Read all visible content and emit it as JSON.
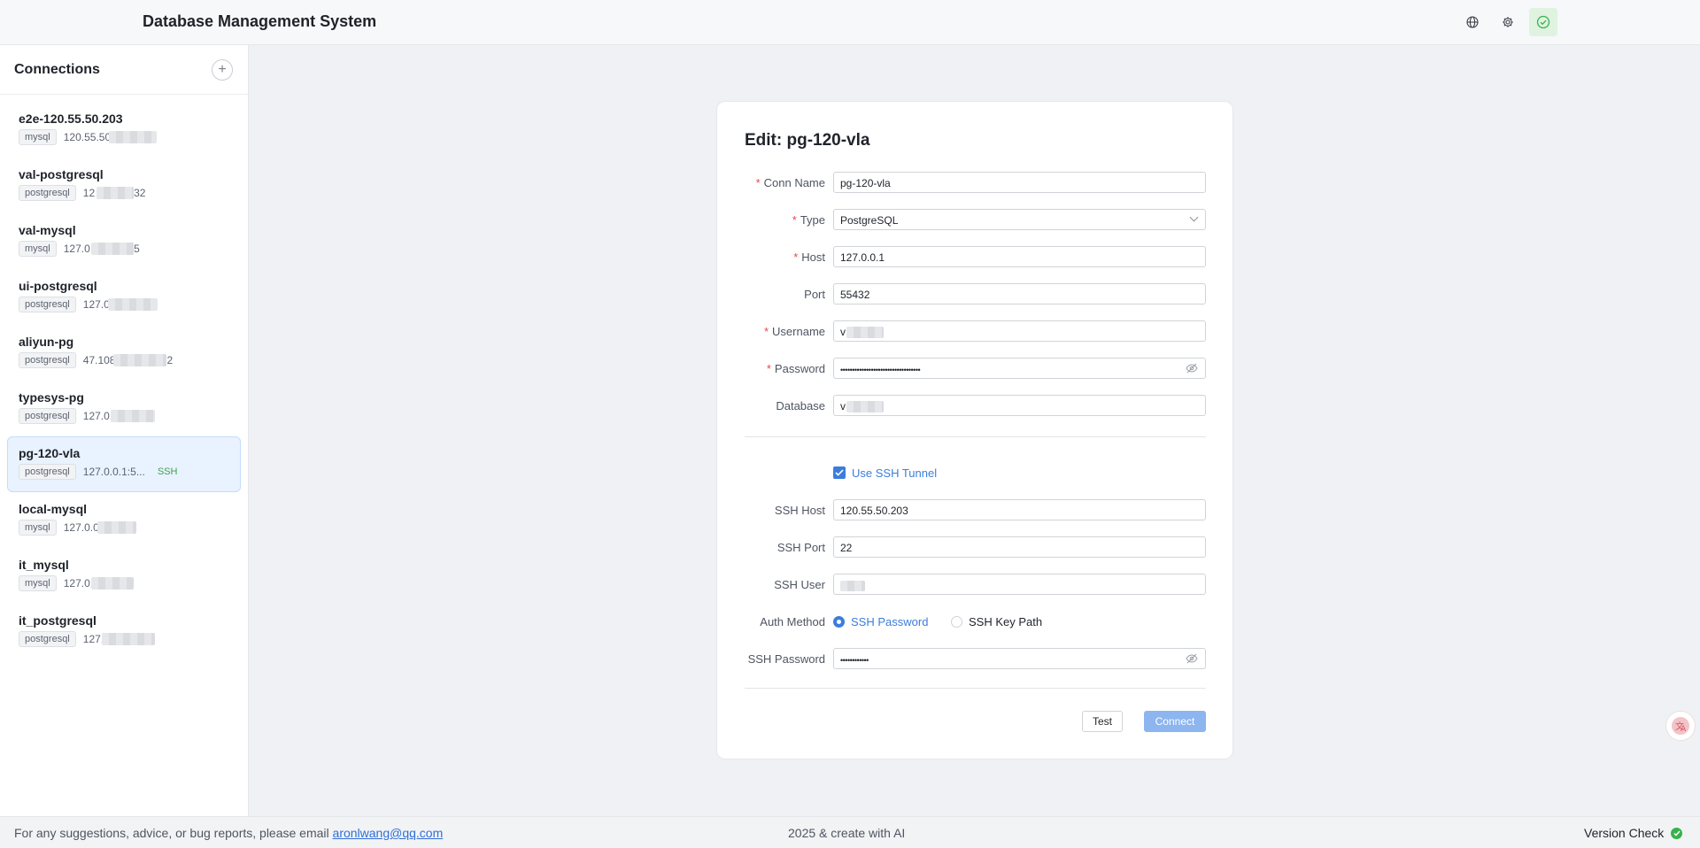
{
  "app": {
    "title": "Database Management System"
  },
  "topbar": {
    "icons": [
      "globe-icon",
      "gear-icon",
      "check-circle-icon"
    ]
  },
  "sidebar": {
    "title": "Connections",
    "add_icon": "plus-icon",
    "items": [
      {
        "name": "e2e-120.55.50.203",
        "type": "mysql",
        "host": "120.55.50",
        "ssh": ""
      },
      {
        "name": "val-postgresql",
        "type": "postgresql",
        "host": "12",
        "host_tail": "32",
        "ssh": ""
      },
      {
        "name": "val-mysql",
        "type": "mysql",
        "host": "127.0.",
        "host_tail": "5",
        "ssh": ""
      },
      {
        "name": "ui-postgresql",
        "type": "postgresql",
        "host": "127.0",
        "ssh": ""
      },
      {
        "name": "aliyun-pg",
        "type": "postgresql",
        "host": "47.108",
        "host_tail": "2",
        "ssh": ""
      },
      {
        "name": "typesys-pg",
        "type": "postgresql",
        "host": "127.0.",
        "ssh": ""
      },
      {
        "name": "pg-120-vla",
        "type": "postgresql",
        "host": "127.0.0.1:5...",
        "ssh": "SSH",
        "active": true
      },
      {
        "name": "local-mysql",
        "type": "mysql",
        "host": "127.0.0",
        "ssh": ""
      },
      {
        "name": "it_mysql",
        "type": "mysql",
        "host": "127.0.",
        "ssh": ""
      },
      {
        "name": "it_postgresql",
        "type": "postgresql",
        "host": "127.",
        "ssh": ""
      }
    ]
  },
  "form": {
    "title": "Edit: pg-120-vla",
    "required_mark": "*",
    "conn_name": {
      "label": "Conn Name",
      "value": "pg-120-vla"
    },
    "type": {
      "label": "Type",
      "value": "PostgreSQL"
    },
    "host": {
      "label": "Host",
      "value": "127.0.0.1"
    },
    "port": {
      "label": "Port",
      "value": "55432"
    },
    "username": {
      "label": "Username",
      "value": "v"
    },
    "password": {
      "label": "Password",
      "value": "••••••••••••••••••••••••••••••••••"
    },
    "database": {
      "label": "Database",
      "value": "v"
    },
    "use_ssh": {
      "label": "Use SSH Tunnel",
      "checked": true
    },
    "ssh_host": {
      "label": "SSH Host",
      "value": "120.55.50.203"
    },
    "ssh_port": {
      "label": "SSH Port",
      "value": "22"
    },
    "ssh_user": {
      "label": "SSH User",
      "value": ""
    },
    "auth_method": {
      "label": "Auth Method",
      "options": [
        "SSH Password",
        "SSH Key Path"
      ],
      "selected": "SSH Password"
    },
    "ssh_password": {
      "label": "SSH Password",
      "value": "••••••••••••"
    },
    "buttons": {
      "test": "Test",
      "connect": "Connect"
    }
  },
  "footer": {
    "left_text": "For any suggestions, advice, or bug reports, please email ",
    "email": "aronlwang@qq.com",
    "center": "2025 & create with AI",
    "right": "Version Check"
  },
  "colors": {
    "accent": "#3b7ddd",
    "required": "#e5484d",
    "ssh_tag": "#3fa34d",
    "ok": "#36b24a"
  }
}
